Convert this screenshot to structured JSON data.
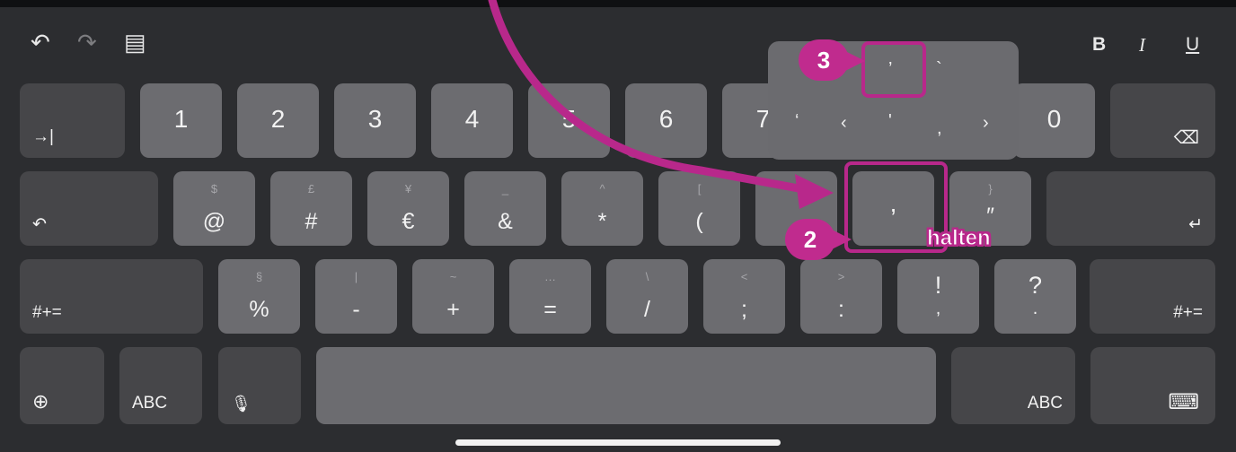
{
  "toolbar": {
    "undo": "↶",
    "redo": "↷",
    "paste": "▤",
    "bold": "B",
    "italic": "I",
    "underline": "U"
  },
  "keys": {
    "tab": "→|",
    "delete": "⌫",
    "undo_key": "↶",
    "return": "↵",
    "shift_left": "#+=",
    "shift_right": "#+=",
    "globe": "⊕",
    "abc_left": "ABC",
    "mic": "🎙",
    "abc_right": "ABC",
    "keyboard_hide": "⌨",
    "row1": [
      "1",
      "2",
      "3",
      "4",
      "5",
      "6",
      "7",
      "0"
    ],
    "row2": [
      {
        "alt": "$",
        "main": "@"
      },
      {
        "alt": "£",
        "main": "#"
      },
      {
        "alt": "¥",
        "main": "€"
      },
      {
        "alt": "_",
        "main": "&"
      },
      {
        "alt": "^",
        "main": "*"
      },
      {
        "alt": "[",
        "main": "("
      },
      {
        "alt": "",
        "main": ","
      },
      {
        "alt": "}",
        "main": "″"
      }
    ],
    "row3": [
      {
        "alt": "§",
        "main": "%"
      },
      {
        "alt": "|",
        "main": "-"
      },
      {
        "alt": "~",
        "main": "+"
      },
      {
        "alt": "…",
        "main": "="
      },
      {
        "alt": "\\",
        "main": "/"
      },
      {
        "alt": "<",
        "main": ";"
      },
      {
        "alt": ">",
        "main": ":"
      },
      {
        "alt": "!",
        "main": ","
      },
      {
        "alt": "?",
        "main": "."
      }
    ]
  },
  "popup": {
    "top": [
      "’",
      "`"
    ],
    "bottom": [
      "‘",
      "‹",
      "'",
      ",",
      "›"
    ]
  },
  "annotations": {
    "step2": "2",
    "step3": "3",
    "hold": "halten",
    "accent_color": "#b8288b"
  }
}
